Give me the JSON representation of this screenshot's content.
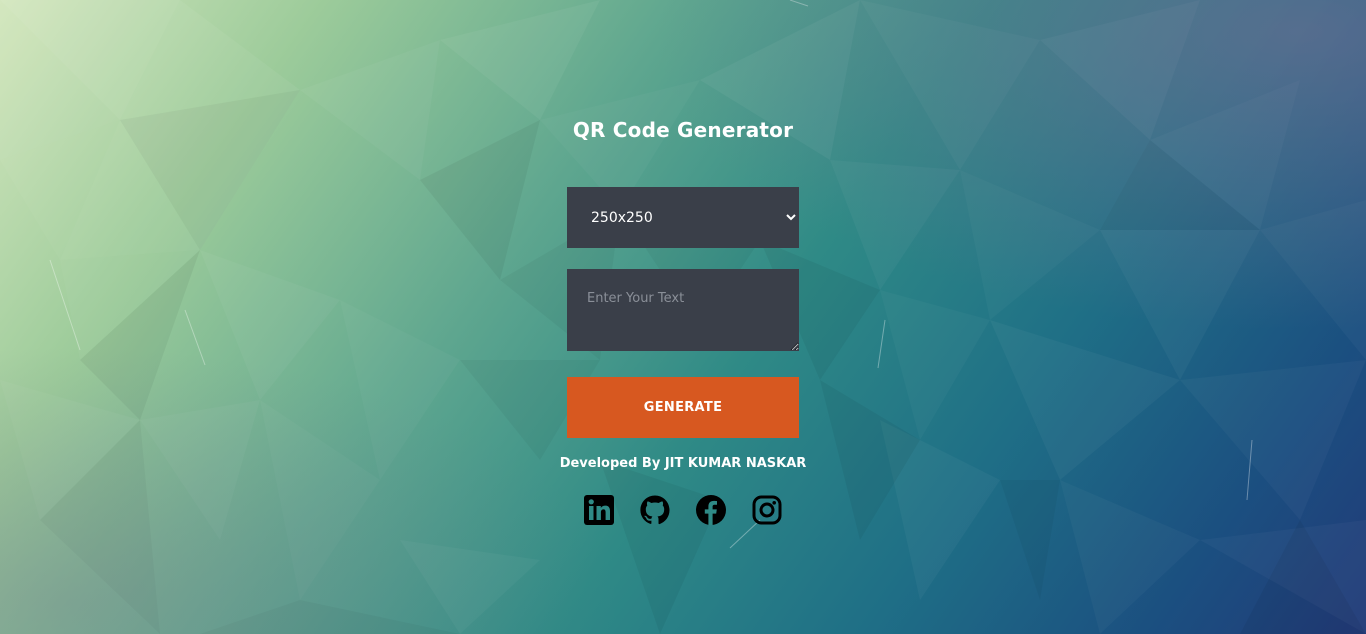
{
  "app": {
    "title": "QR Code Generator"
  },
  "form": {
    "size_select": {
      "selected": "250x250",
      "options": [
        "250x250"
      ]
    },
    "text_input": {
      "value": "",
      "placeholder": "Enter Your Text"
    },
    "generate_label": "GENERATE"
  },
  "footer": {
    "credit": "Developed By JIT KUMAR NASKAR",
    "socials": [
      {
        "icon": "linkedin-icon"
      },
      {
        "icon": "github-icon"
      },
      {
        "icon": "facebook-icon"
      },
      {
        "icon": "instagram-icon"
      }
    ]
  },
  "colors": {
    "field_bg": "#3a3f49",
    "button_bg": "#d75820",
    "text": "#ffffff",
    "icon": "#000000"
  }
}
